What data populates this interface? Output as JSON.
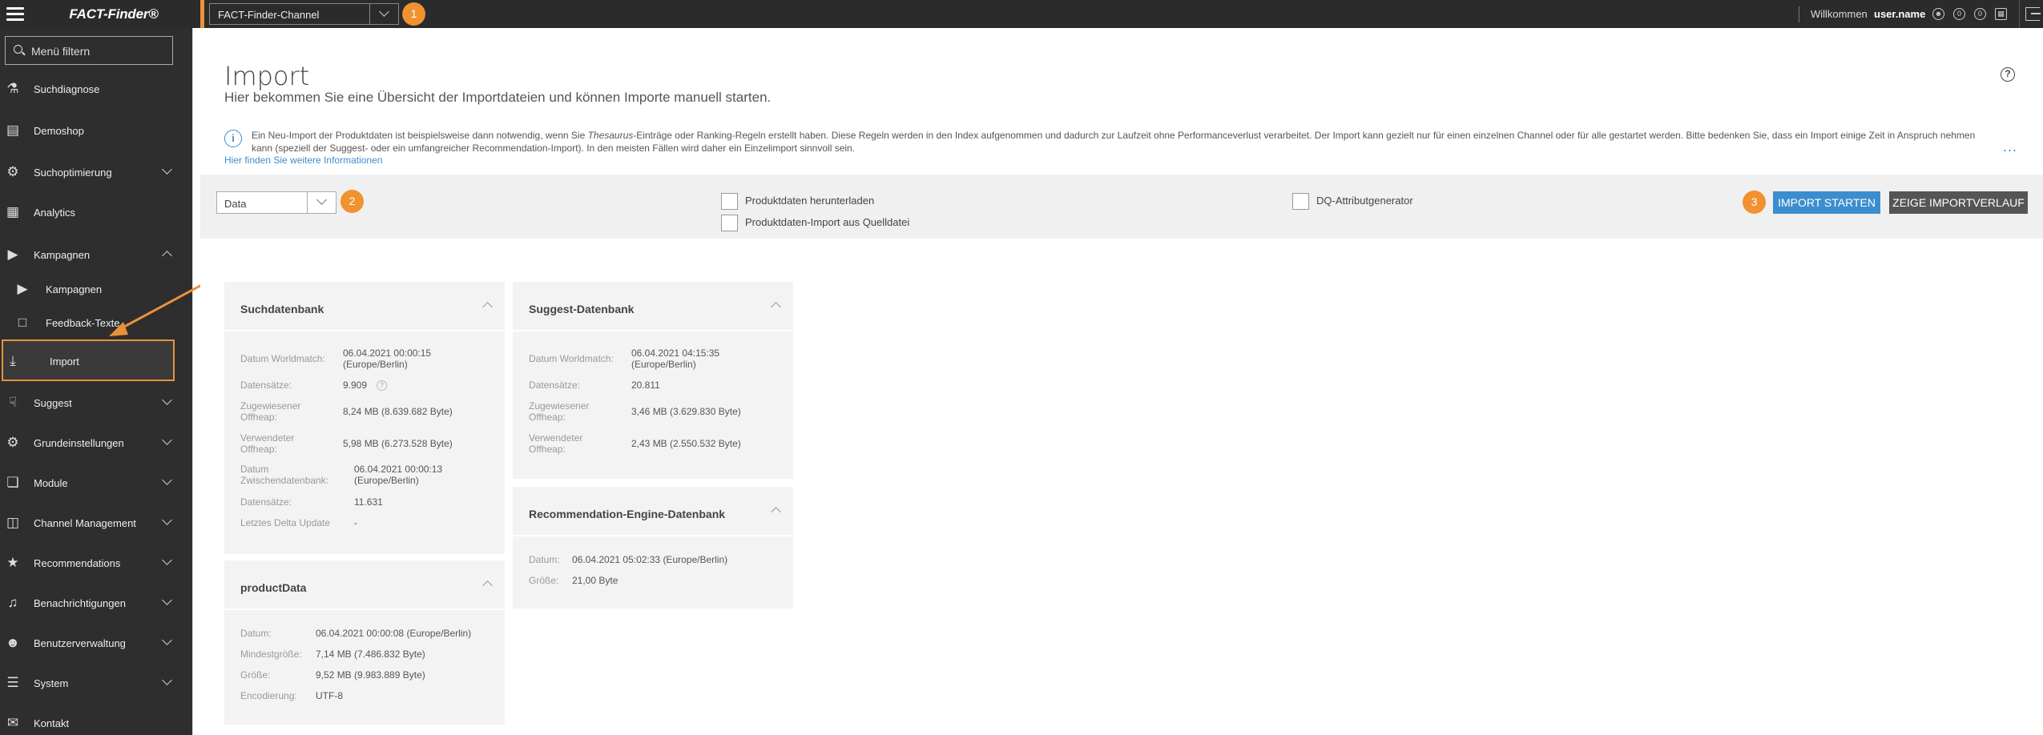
{
  "topbar": {
    "brand": "FACT-Finder®",
    "channel_value": "FACT-Finder-Channel",
    "badge1": "1",
    "welcome": "Willkommen",
    "username": "user.name",
    "icon_badge_a": "0",
    "icon_badge_b": "0"
  },
  "sidebar": {
    "filter_placeholder": "Menü filtern",
    "items": [
      {
        "label": "Suchdiagnose",
        "icon": "flask-icon"
      },
      {
        "label": "Demoshop",
        "icon": "cart-icon"
      },
      {
        "label": "Suchoptimierung",
        "icon": "gears-icon"
      },
      {
        "label": "Analytics",
        "icon": "chart-icon"
      },
      {
        "label": "Kampagnen",
        "icon": "megaphone-icon"
      },
      {
        "label": "Kampagnen",
        "icon": "megaphone-icon"
      },
      {
        "label": "Feedback-Texte",
        "icon": "feedback-icon"
      },
      {
        "label": "Import",
        "icon": "download-icon"
      },
      {
        "label": "Suggest",
        "icon": "suggest-icon"
      },
      {
        "label": "Grundeinstellungen",
        "icon": "settings-icon"
      },
      {
        "label": "Module",
        "icon": "cube-icon"
      },
      {
        "label": "Channel Management",
        "icon": "channel-icon"
      },
      {
        "label": "Recommendations",
        "icon": "star-icon"
      },
      {
        "label": "Benachrichtigungen",
        "icon": "bell-icon"
      },
      {
        "label": "Benutzerverwaltung",
        "icon": "users-icon"
      },
      {
        "label": "System",
        "icon": "sliders-icon"
      },
      {
        "label": "Kontakt",
        "icon": "mail-icon"
      }
    ]
  },
  "page": {
    "title": "Import",
    "subtitle": "Hier bekommen Sie eine Übersicht der Importdateien und können Importe manuell starten.",
    "info_text_pre": "Ein Neu-Import der Produktdaten ist beispielsweise dann notwendig, wenn Sie ",
    "info_text_em": "Thesaurus",
    "info_text_post": "-Einträge oder Ranking-Regeln erstellt haben. Diese Regeln werden in den Index aufgenommen und dadurch zur Laufzeit ohne Performanceverlust verarbeitet. Der Import kann gezielt nur für einen einzelnen Channel oder für alle gestartet werden. Bitte bedenken Sie, dass ein Import einige Zeit in Anspruch nehmen kann (speziell der Suggest- oder ein umfangreicher Recommendation-Import). In den meisten Fällen wird daher ein Einzelimport sinnvoll sein.",
    "info_link": "Hier finden Sie weitere Informationen",
    "more": "..."
  },
  "toolbar": {
    "select_value": "Data",
    "badge2": "2",
    "badge3": "3",
    "cb_download": "Produktdaten herunterladen",
    "cb_source": "Produktdaten-Import aus Quelldatei",
    "cb_dq": "DQ-Attributgenerator",
    "btn_start": "IMPORT STARTEN",
    "btn_history": "ZEIGE IMPORTVERLAUF"
  },
  "cards": {
    "suchdatenbank": {
      "title": "Suchdatenbank",
      "rows": [
        {
          "label": "Datum Worldmatch:",
          "value": "06.04.2021 00:00:15\n(Europe/Berlin)"
        },
        {
          "label": "Datensätze:",
          "value": "9.909"
        },
        {
          "label": "Zugewiesener\nOffheap:",
          "value": "8,24 MB (8.639.682 Byte)"
        },
        {
          "label": "Verwendeter\nOffheap:",
          "value": "5,98 MB (6.273.528 Byte)"
        },
        {
          "label": "Datum\nZwischendatenbank:",
          "value": "06.04.2021 00:00:13\n(Europe/Berlin)"
        },
        {
          "label": "Datensätze:",
          "value": "11.631"
        },
        {
          "label": "Letztes Delta Update",
          "value": "-"
        }
      ]
    },
    "suggest": {
      "title": "Suggest-Datenbank",
      "rows": [
        {
          "label": "Datum Worldmatch:",
          "value": "06.04.2021 04:15:35\n(Europe/Berlin)"
        },
        {
          "label": "Datensätze:",
          "value": "20.811"
        },
        {
          "label": "Zugewiesener\nOffheap:",
          "value": "3,46 MB (3.629.830 Byte)"
        },
        {
          "label": "Verwendeter\nOffheap:",
          "value": "2,43 MB (2.550.532 Byte)"
        }
      ]
    },
    "recommendation": {
      "title": "Recommendation-Engine-Datenbank",
      "rows": [
        {
          "label": "Datum:",
          "value": "06.04.2021 05:02:33 (Europe/Berlin)"
        },
        {
          "label": "Größe:",
          "value": "21,00 Byte"
        }
      ]
    },
    "productdata": {
      "title": "productData",
      "rows": [
        {
          "label": "Datum:",
          "value": "06.04.2021 00:00:08 (Europe/Berlin)"
        },
        {
          "label": "Mindestgröße:",
          "value": "7,14 MB (7.486.832 Byte)"
        },
        {
          "label": "Größe:",
          "value": "9,52 MB (9.983.889 Byte)"
        },
        {
          "label": "Encodierung:",
          "value": "UTF-8"
        }
      ]
    }
  }
}
